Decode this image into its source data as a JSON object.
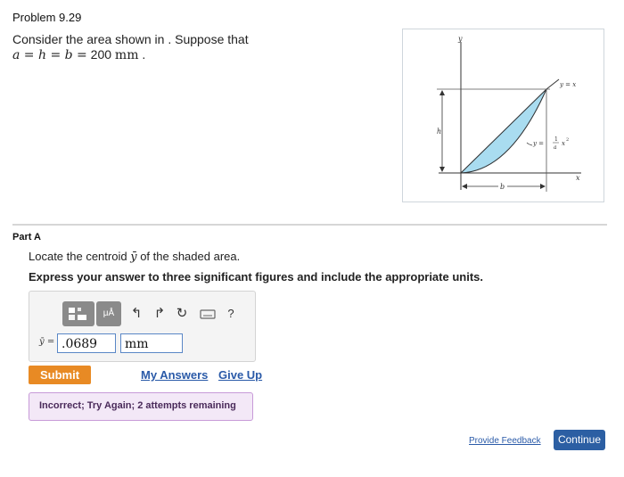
{
  "problem": {
    "title": "Problem 9.29",
    "statement_line1": "Consider the area shown in . Suppose that",
    "equation_vars": "a = h = b =",
    "equation_value": "200",
    "equation_unit": "mm",
    "equation_end": "."
  },
  "figure": {
    "y_axis_label": "y",
    "x_axis_label": "x",
    "h_label": "h",
    "b_label": "b",
    "line_label": "y = x",
    "curve_label_prefix": "y =",
    "curve_label_frac_num": "1",
    "curve_label_frac_den": "a",
    "curve_label_suffix": "x",
    "curve_label_exp": "2",
    "shade_color": "#a9dcf0"
  },
  "part": {
    "label": "Part A",
    "instruction_pre": "Locate the centroid",
    "instruction_var": "ȳ",
    "instruction_post": "of the shaded area.",
    "express": "Express your answer to three significant figures and include the appropriate units."
  },
  "toolbar": {
    "templates_icon": "templates-icon",
    "units_label": "μÅ",
    "undo_icon": "undo-icon",
    "redo_icon": "redo-icon",
    "reset_icon": "reset-icon",
    "keyboard_icon": "keyboard-icon",
    "help_label": "?"
  },
  "answer": {
    "var_label": "ȳ =",
    "value": ".0689",
    "units": "mm"
  },
  "actions": {
    "submit_label": "Submit",
    "my_answers_label": "My Answers",
    "give_up_label": "Give Up"
  },
  "feedback": {
    "message": "Incorrect; Try Again; 2 attempts remaining"
  },
  "footer": {
    "provide_feedback_label": "Provide Feedback",
    "continue_label": "Continue"
  },
  "colors": {
    "submit": "#e88a24",
    "continue": "#2c5fa3",
    "feedback_bg": "#f3e8f7",
    "feedback_border": "#c79ad8",
    "link": "#2a5aa8"
  }
}
